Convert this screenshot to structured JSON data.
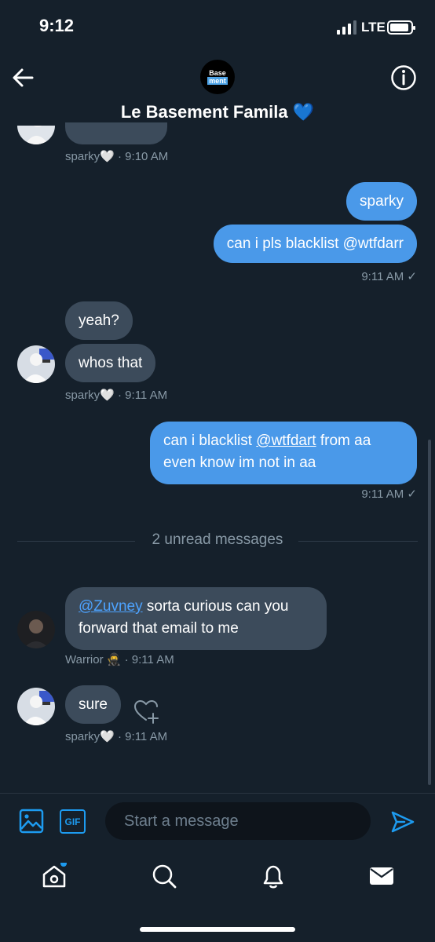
{
  "status_bar": {
    "time": "9:12",
    "network": "LTE"
  },
  "header": {
    "title": "Le Basement Famila",
    "title_emoji": "💙",
    "avatar_line1": "Base",
    "avatar_line2": "ment"
  },
  "messages": {
    "m0_meta": "sparky🤍 · 9:10 AM",
    "m1_text": "sparky",
    "m2_text": "can i pls blacklist @wtfdarr",
    "m2_meta": "9:11 AM ✓",
    "m3_text": "yeah?",
    "m4_text": "whos that",
    "m4_meta": "sparky🤍 · 9:11 AM",
    "m5_pre": "can i blacklist ",
    "m5_mention": "@wtfdart",
    "m5_post": " from aa even know im not in aa",
    "m5_meta": "9:11 AM ✓",
    "unread": "2 unread messages",
    "m6_mention": "@Zuvney",
    "m6_post": " sorta curious can you forward that email to me",
    "m6_meta": "Warrior 🥷 · 9:11 AM",
    "m7_text": "sure",
    "m7_meta": "sparky🤍 · 9:11 AM"
  },
  "composer": {
    "placeholder": "Start a message",
    "gif_label": "GIF"
  },
  "icons": {
    "back": "arrow-left-icon",
    "info": "info-icon",
    "image": "image-icon",
    "gif": "gif-icon",
    "send": "send-icon",
    "react": "heart-plus-icon",
    "home": "home-icon",
    "search": "search-icon",
    "notifications": "bell-icon",
    "messages": "mail-icon"
  },
  "colors": {
    "background": "#15202b",
    "incoming_bubble": "#3c4b5b",
    "outgoing_bubble": "#4a99e9",
    "accent": "#1d9bf0",
    "meta_text": "#8899a6"
  }
}
